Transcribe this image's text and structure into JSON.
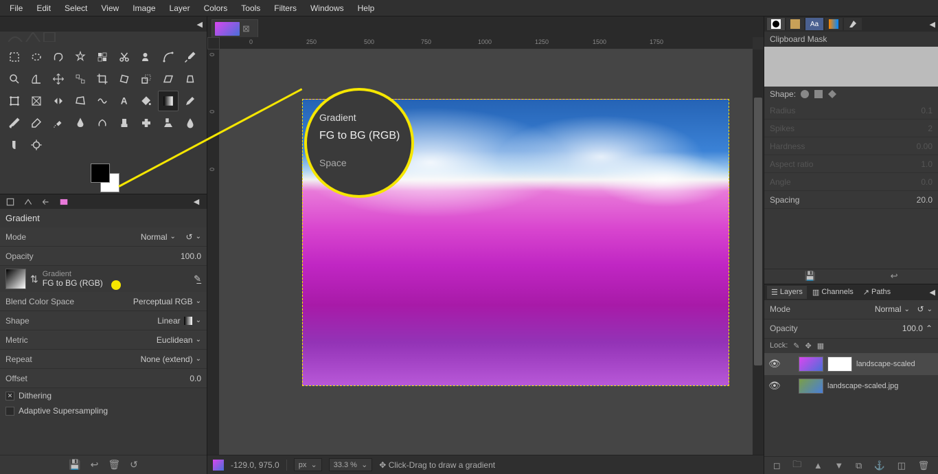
{
  "menu": [
    "File",
    "Edit",
    "Select",
    "View",
    "Image",
    "Layer",
    "Colors",
    "Tools",
    "Filters",
    "Windows",
    "Help"
  ],
  "toolopts": {
    "title": "Gradient",
    "mode_label": "Mode",
    "mode_value": "Normal",
    "opacity_label": "Opacity",
    "opacity_value": "100.0",
    "gradient_label": "Gradient",
    "gradient_name": "FG to BG (RGB)",
    "blend_label": "Blend Color Space",
    "blend_value": "Perceptual RGB",
    "shape_label": "Shape",
    "shape_value": "Linear",
    "metric_label": "Metric",
    "metric_value": "Euclidean",
    "repeat_label": "Repeat",
    "repeat_value": "None (extend)",
    "offset_label": "Offset",
    "offset_value": "0.0",
    "dithering": "Dithering",
    "adaptive": "Adaptive Supersampling"
  },
  "status": {
    "coords": "-129.0, 975.0",
    "unit": "px",
    "zoom": "33.3 %",
    "hint": "Click-Drag to draw a gradient"
  },
  "right": {
    "brush_title": "Clipboard Mask",
    "shape_label": "Shape:",
    "radius_label": "Radius",
    "radius_val": "0.1",
    "spikes_label": "Spikes",
    "spikes_val": "2",
    "hardness_label": "Hardness",
    "hardness_val": "0.00",
    "aspect_label": "Aspect ratio",
    "aspect_val": "1.0",
    "angle_label": "Angle",
    "angle_val": "0.0",
    "spacing_label": "Spacing",
    "spacing_val": "20.0",
    "layers_tab": "Layers",
    "channels_tab": "Channels",
    "paths_tab": "Paths",
    "mode_label": "Mode",
    "mode_value": "Normal",
    "opacity_label": "Opacity",
    "opacity_value": "100.0",
    "lock_label": "Lock:",
    "layer1": "landscape-scaled",
    "layer2": "landscape-scaled.jpg"
  },
  "callout": {
    "label": "Gradient",
    "value": "FG to BG (RGB)",
    "below": "Space"
  },
  "ruler_h": [
    {
      "p": 43,
      "v": "0"
    },
    {
      "p": 126,
      "v": "250"
    },
    {
      "p": 210,
      "v": "500"
    },
    {
      "p": 293,
      "v": "750"
    },
    {
      "p": 376,
      "v": "1000"
    },
    {
      "p": 459,
      "v": "1250"
    },
    {
      "p": 543,
      "v": "1500"
    },
    {
      "p": 626,
      "v": "1750"
    }
  ],
  "ruler_v": [
    {
      "p": 5,
      "v": "0"
    },
    {
      "p": 88,
      "v": "0"
    },
    {
      "p": 172,
      "v": "0"
    }
  ]
}
